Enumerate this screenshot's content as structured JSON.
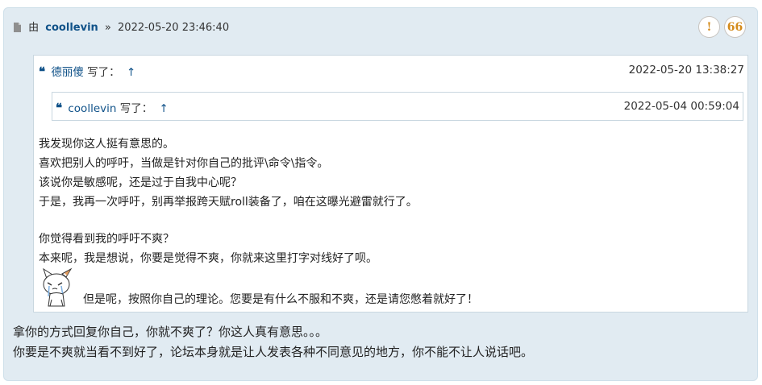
{
  "post": {
    "by_label": "由",
    "author": "coollevin",
    "separator": "»",
    "datetime": "2022-05-20 23:46:40",
    "buttons": [
      {
        "label": "!",
        "icon": "report-icon"
      },
      {
        "label": "66",
        "icon": "quote-icon"
      }
    ]
  },
  "outer_quote": {
    "author": "德丽傻",
    "wrote": "写了：",
    "arrow": "↑",
    "datetime": "2022-05-20 13:38:27",
    "inner_quote": {
      "author": "coollevin",
      "wrote": "写了：",
      "arrow": "↑",
      "datetime": "2022-05-04 00:59:04"
    },
    "lines": [
      "我发现你这人挺有意思的。",
      "喜欢把别人的呼吁，当做是针对你自己的批评\\命令\\指令。",
      "该说你是敏感呢，还是过于自我中心呢？",
      "于是，我再一次呼吁，别再举报跨天赋roll装备了，咱在这曝光避雷就行了。",
      "你觉得看到我的呼吁不爽？",
      "本来呢，我是想说，你要是觉得不爽，你就来这里打字对线好了呗。"
    ],
    "smiley_line": "但是呢，按照你自己的理论。您要是有什么不服和不爽，还是请您憋着就好了！"
  },
  "reply": {
    "lines": [
      "拿你的方式回复你自己，你就不爽了？你这人真有意思。。。",
      "你要是不爽就当看不到好了，论坛本身就是让人发表各种不同意见的地方，你不能不让人说话吧。"
    ]
  }
}
